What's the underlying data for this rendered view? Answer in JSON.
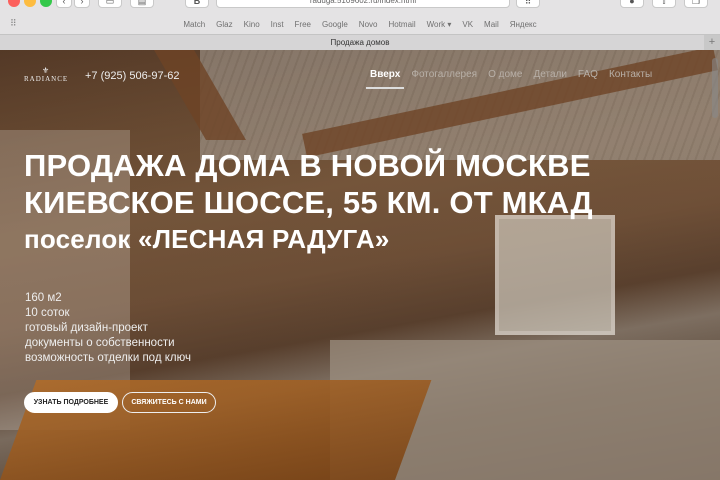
{
  "browser": {
    "url": "raduga.5109602.ru/index.html",
    "favorites": [
      "Match",
      "Glaz",
      "Kino",
      "Inst",
      "Free",
      "Google",
      "Novo",
      "Hotmail",
      "Work ▾",
      "VK",
      "Mail",
      "Яндекс"
    ],
    "tab_title": "Продажа домов"
  },
  "header": {
    "logo": "RADIANCE",
    "phone": "+7 (925) 506-97-62",
    "nav": [
      "Вверх",
      "Фотогаллерея",
      "О доме",
      "Детали",
      "FAQ",
      "Контакты"
    ]
  },
  "hero": {
    "title_line1": "ПРОДАЖА ДОМА В НОВОЙ МОСКВЕ",
    "title_line2": "КИЕВСКОЕ ШОССЕ, 55 КМ. ОТ МКАД",
    "title_line3": "поселок «ЛЕСНАЯ РАДУГА»",
    "features": [
      "160 м2",
      "10 соток",
      "готовый дизайн-проект",
      "документы о собственности",
      "возможность отделки под ключ"
    ],
    "primary_button": "УЗНАТЬ ПОДРОБНЕЕ",
    "secondary_button": "СВЯЖИТЕСЬ С НАМИ"
  }
}
